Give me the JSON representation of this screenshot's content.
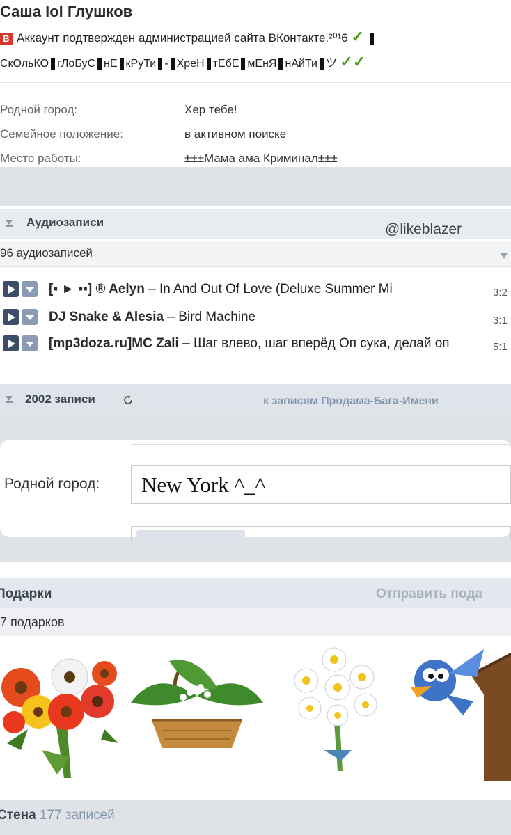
{
  "profile": {
    "name": "Саша lol Глушков",
    "badge_letter": "В",
    "verified_text": "Аккаунт подтвержден администрацией сайта ВКонтакте.",
    "verified_year": "²⁰¹6",
    "status_parts": [
      "СкОльКО",
      "гЛоБуС",
      "нЕ",
      "кРуТи",
      "-",
      "ХреН",
      "тЕбЕ",
      "мЕнЯ",
      "нАйТи",
      "ツ"
    ],
    "fields": [
      {
        "label": "Родной город:",
        "value": "Хер тебе!"
      },
      {
        "label": "Семейное положение:",
        "value": "в активном поиске"
      },
      {
        "label": "Место работы:",
        "value": "±±±Мама ама Криминал±±±"
      }
    ]
  },
  "watermark": "@likeblazer",
  "audio": {
    "title": "Аудиозаписи",
    "count": "96 аудиозаписей",
    "tracks": [
      {
        "artist": "[▪ ► ▪▪] ® Aelyn",
        "title": "In And Out Of Love (Deluxe Summer Mi",
        "duration": "3:2"
      },
      {
        "artist": "DJ Snake & Alesia",
        "title": "Bird Machine",
        "duration": "3:1"
      },
      {
        "artist": "[mp3doza.ru]MC Zali",
        "title": "Шаг влево, шаг вперёд Оп сука, делай оп",
        "duration": "5:1"
      }
    ]
  },
  "posts": {
    "count": "2002 записи",
    "link": "к записям Продама-Бага-Имени"
  },
  "popup": {
    "label": "Родной город:",
    "value": "New York ^_^"
  },
  "gifts": {
    "title": "Подарки",
    "send_link": "Отправить пода",
    "count": "7 подарков",
    "items": [
      "flower-bouquet",
      "lily-basket",
      "daisy-bouquet",
      "bird-clock"
    ]
  },
  "wall": {
    "title": "Стена",
    "count": "177 записей"
  },
  "colors": {
    "verified_check": "#4a9a1f",
    "badge": "#d8372c",
    "link": "#8597ad"
  }
}
